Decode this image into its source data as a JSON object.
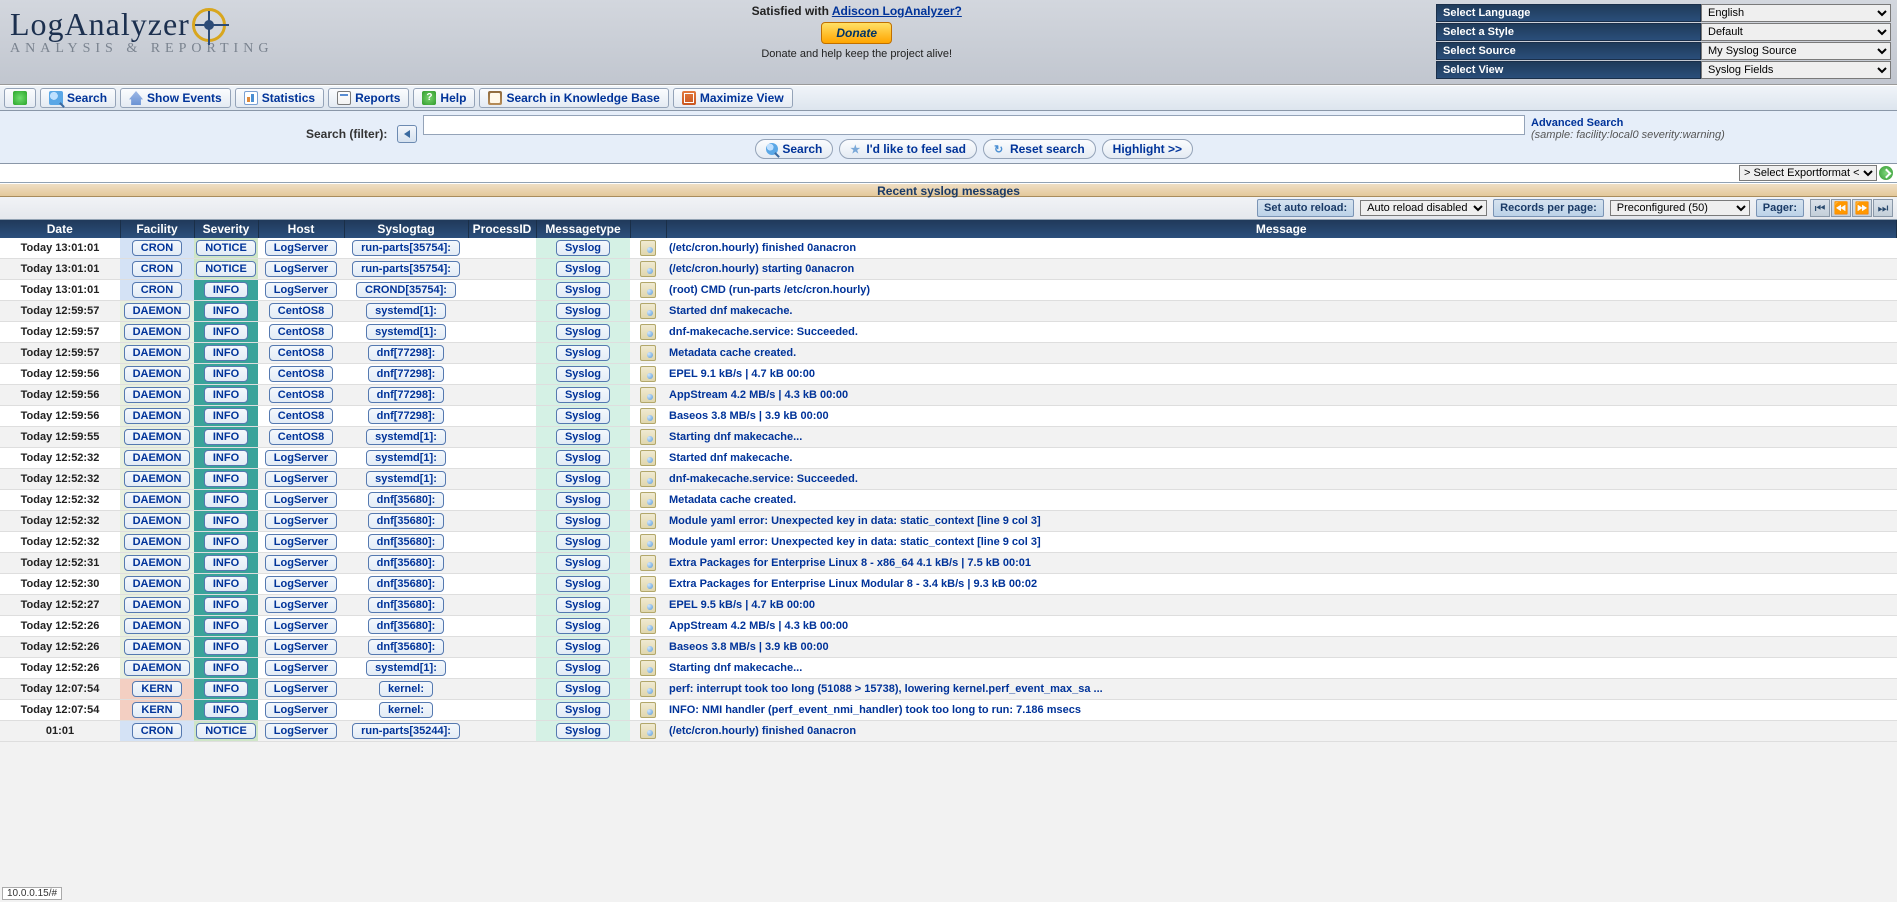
{
  "header": {
    "logo_main": "LogAnalyzer",
    "logo_sub": "ANALYSIS & REPORTING",
    "donate_q_pre": "Satisfied with ",
    "donate_q_link": "Adiscon LogAnalyzer?",
    "donate_btn": "Donate",
    "donate_help": "Donate and help keep the project alive!"
  },
  "selects": [
    {
      "label": "Select Language",
      "value": "English"
    },
    {
      "label": "Select a Style",
      "value": "Default"
    },
    {
      "label": "Select Source",
      "value": "My Syslog Source"
    },
    {
      "label": "Select View",
      "value": "Syslog Fields"
    }
  ],
  "toolbar": {
    "search": "Search",
    "show_events": "Show Events",
    "statistics": "Statistics",
    "reports": "Reports",
    "help": "Help",
    "search_kb": "Search in Knowledge Base",
    "maximize": "Maximize View"
  },
  "searchbar": {
    "label": "Search (filter):",
    "search_btn": "Search",
    "feel_sad": "I'd like to feel sad",
    "reset": "Reset search",
    "highlight": "Highlight >>",
    "adv": "Advanced Search",
    "sample": "(sample: facility:local0 severity:warning)",
    "input_value": ""
  },
  "band_title": "Recent syslog messages",
  "export": {
    "placeholder": "> Select Exportformat <"
  },
  "grid_controls": {
    "auto_label": "Set auto reload:",
    "auto_value": "Auto reload disabled",
    "rpp_label": "Records per page:",
    "rpp_value": "Preconfigured (50)",
    "pager_label": "Pager:"
  },
  "columns": [
    "Date",
    "Facility",
    "Severity",
    "Host",
    "Syslogtag",
    "ProcessID",
    "Messagetype",
    "",
    "Message"
  ],
  "rows": [
    {
      "date": "Today 13:01:01",
      "fac": "CRON",
      "facbg": "cron",
      "sev": "NOTICE",
      "sevbg": "notice",
      "host": "LogServer",
      "tag": "run-parts[35754]:",
      "mtype": "Syslog",
      "msg": "(/etc/cron.hourly) finished 0anacron"
    },
    {
      "date": "Today 13:01:01",
      "fac": "CRON",
      "facbg": "cron",
      "sev": "NOTICE",
      "sevbg": "notice",
      "host": "LogServer",
      "tag": "run-parts[35754]:",
      "mtype": "Syslog",
      "msg": "(/etc/cron.hourly) starting 0anacron"
    },
    {
      "date": "Today 13:01:01",
      "fac": "CRON",
      "facbg": "cron",
      "sev": "INFO",
      "sevbg": "info",
      "host": "LogServer",
      "tag": "CROND[35754]:",
      "mtype": "Syslog",
      "msg": "(root) CMD (run-parts /etc/cron.hourly)"
    },
    {
      "date": "Today 12:59:57",
      "fac": "DAEMON",
      "facbg": "daemon",
      "sev": "INFO",
      "sevbg": "info",
      "host": "CentOS8",
      "tag": "systemd[1]:",
      "mtype": "Syslog",
      "msg": "Started dnf makecache."
    },
    {
      "date": "Today 12:59:57",
      "fac": "DAEMON",
      "facbg": "daemon",
      "sev": "INFO",
      "sevbg": "info",
      "host": "CentOS8",
      "tag": "systemd[1]:",
      "mtype": "Syslog",
      "msg": "dnf-makecache.service: Succeeded."
    },
    {
      "date": "Today 12:59:57",
      "fac": "DAEMON",
      "facbg": "daemon",
      "sev": "INFO",
      "sevbg": "info",
      "host": "CentOS8",
      "tag": "dnf[77298]:",
      "mtype": "Syslog",
      "msg": "Metadata cache created."
    },
    {
      "date": "Today 12:59:56",
      "fac": "DAEMON",
      "facbg": "daemon",
      "sev": "INFO",
      "sevbg": "info",
      "host": "CentOS8",
      "tag": "dnf[77298]:",
      "mtype": "Syslog",
      "msg": "EPEL 9.1 kB/s | 4.7 kB 00:00"
    },
    {
      "date": "Today 12:59:56",
      "fac": "DAEMON",
      "facbg": "daemon",
      "sev": "INFO",
      "sevbg": "info",
      "host": "CentOS8",
      "tag": "dnf[77298]:",
      "mtype": "Syslog",
      "msg": "AppStream 4.2 MB/s | 4.3 kB 00:00"
    },
    {
      "date": "Today 12:59:56",
      "fac": "DAEMON",
      "facbg": "daemon",
      "sev": "INFO",
      "sevbg": "info",
      "host": "CentOS8",
      "tag": "dnf[77298]:",
      "mtype": "Syslog",
      "msg": "Baseos 3.8 MB/s | 3.9 kB 00:00"
    },
    {
      "date": "Today 12:59:55",
      "fac": "DAEMON",
      "facbg": "daemon",
      "sev": "INFO",
      "sevbg": "info",
      "host": "CentOS8",
      "tag": "systemd[1]:",
      "mtype": "Syslog",
      "msg": "Starting dnf makecache..."
    },
    {
      "date": "Today 12:52:32",
      "fac": "DAEMON",
      "facbg": "daemon",
      "sev": "INFO",
      "sevbg": "info",
      "host": "LogServer",
      "tag": "systemd[1]:",
      "mtype": "Syslog",
      "msg": "Started dnf makecache."
    },
    {
      "date": "Today 12:52:32",
      "fac": "DAEMON",
      "facbg": "daemon",
      "sev": "INFO",
      "sevbg": "info",
      "host": "LogServer",
      "tag": "systemd[1]:",
      "mtype": "Syslog",
      "msg": "dnf-makecache.service: Succeeded."
    },
    {
      "date": "Today 12:52:32",
      "fac": "DAEMON",
      "facbg": "daemon",
      "sev": "INFO",
      "sevbg": "info",
      "host": "LogServer",
      "tag": "dnf[35680]:",
      "mtype": "Syslog",
      "msg": "Metadata cache created."
    },
    {
      "date": "Today 12:52:32",
      "fac": "DAEMON",
      "facbg": "daemon",
      "sev": "INFO",
      "sevbg": "info",
      "host": "LogServer",
      "tag": "dnf[35680]:",
      "mtype": "Syslog",
      "msg": "Module yaml error: Unexpected key in data: static_context [line 9 col 3]"
    },
    {
      "date": "Today 12:52:32",
      "fac": "DAEMON",
      "facbg": "daemon",
      "sev": "INFO",
      "sevbg": "info",
      "host": "LogServer",
      "tag": "dnf[35680]:",
      "mtype": "Syslog",
      "msg": "Module yaml error: Unexpected key in data: static_context [line 9 col 3]"
    },
    {
      "date": "Today 12:52:31",
      "fac": "DAEMON",
      "facbg": "daemon",
      "sev": "INFO",
      "sevbg": "info",
      "host": "LogServer",
      "tag": "dnf[35680]:",
      "mtype": "Syslog",
      "msg": "Extra Packages for Enterprise Linux 8 - x86_64 4.1 kB/s | 7.5 kB 00:01"
    },
    {
      "date": "Today 12:52:30",
      "fac": "DAEMON",
      "facbg": "daemon",
      "sev": "INFO",
      "sevbg": "info",
      "host": "LogServer",
      "tag": "dnf[35680]:",
      "mtype": "Syslog",
      "msg": "Extra Packages for Enterprise Linux Modular 8 - 3.4 kB/s | 9.3 kB 00:02"
    },
    {
      "date": "Today 12:52:27",
      "fac": "DAEMON",
      "facbg": "daemon",
      "sev": "INFO",
      "sevbg": "info",
      "host": "LogServer",
      "tag": "dnf[35680]:",
      "mtype": "Syslog",
      "msg": "EPEL 9.5 kB/s | 4.7 kB 00:00"
    },
    {
      "date": "Today 12:52:26",
      "fac": "DAEMON",
      "facbg": "daemon",
      "sev": "INFO",
      "sevbg": "info",
      "host": "LogServer",
      "tag": "dnf[35680]:",
      "mtype": "Syslog",
      "msg": "AppStream 4.2 MB/s | 4.3 kB 00:00"
    },
    {
      "date": "Today 12:52:26",
      "fac": "DAEMON",
      "facbg": "daemon",
      "sev": "INFO",
      "sevbg": "info",
      "host": "LogServer",
      "tag": "dnf[35680]:",
      "mtype": "Syslog",
      "msg": "Baseos 3.8 MB/s | 3.9 kB 00:00"
    },
    {
      "date": "Today 12:52:26",
      "fac": "DAEMON",
      "facbg": "daemon",
      "sev": "INFO",
      "sevbg": "info",
      "host": "LogServer",
      "tag": "systemd[1]:",
      "mtype": "Syslog",
      "msg": "Starting dnf makecache..."
    },
    {
      "date": "Today 12:07:54",
      "fac": "KERN",
      "facbg": "kern",
      "sev": "INFO",
      "sevbg": "info",
      "host": "LogServer",
      "tag": "kernel:",
      "mtype": "Syslog",
      "msg": "perf: interrupt took too long (51088 > 15738), lowering kernel.perf_event_max_sa ..."
    },
    {
      "date": "Today 12:07:54",
      "fac": "KERN",
      "facbg": "kern",
      "sev": "INFO",
      "sevbg": "info",
      "host": "LogServer",
      "tag": "kernel:",
      "mtype": "Syslog",
      "msg": "INFO: NMI handler (perf_event_nmi_handler) took too long to run: 7.186 msecs"
    },
    {
      "date": "01:01",
      "fac": "CRON",
      "facbg": "cron",
      "sev": "NOTICE",
      "sevbg": "notice",
      "host": "LogServer",
      "tag": "run-parts[35244]:",
      "mtype": "Syslog",
      "msg": "(/etc/cron.hourly) finished 0anacron"
    }
  ],
  "status_corner": "10.0.0.15/#"
}
